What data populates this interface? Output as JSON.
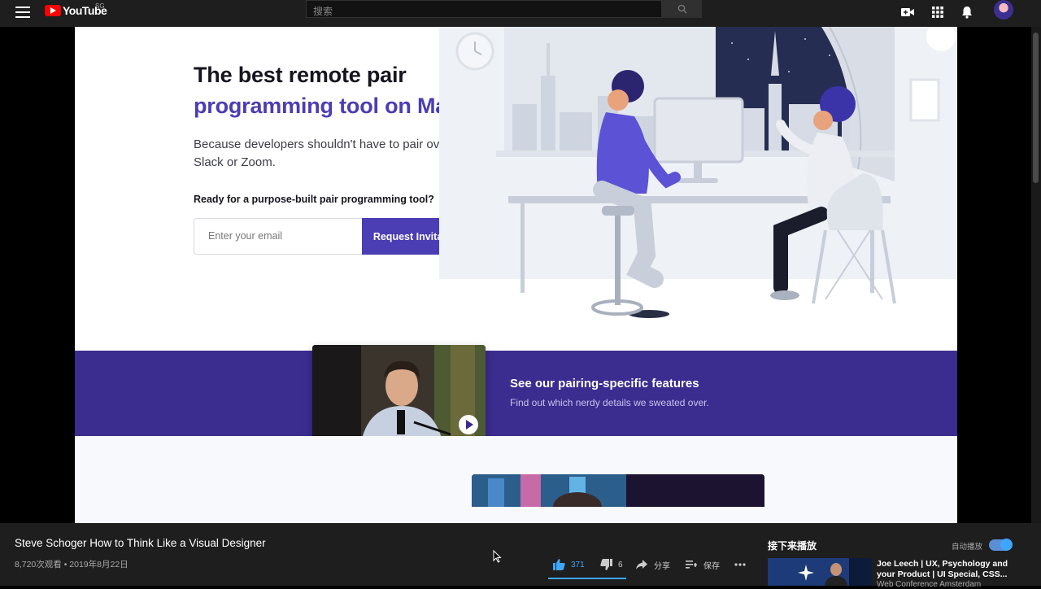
{
  "topbar": {
    "logo_text": "YouTube",
    "region": "SG",
    "search_placeholder": "搜索"
  },
  "page": {
    "hero_title_line1": "The best remote pair",
    "hero_title_line2": "programming tool on Mac",
    "hero_subtitle": "Because developers shouldn't have to pair over Slack or Zoom.",
    "hero_question": "Ready for a purpose-built pair programming tool?",
    "email_placeholder": "Enter your email",
    "request_button": "Request Invitation",
    "features_title": "See our pairing-specific features",
    "features_subtitle": "Find out which nerdy details we sweated over."
  },
  "video": {
    "title": "Steve Schoger How to Think Like a Visual Designer",
    "meta": "8,720次观看 • 2019年8月22日",
    "likes": "371",
    "dislikes": "6",
    "share": "分享",
    "save": "保存"
  },
  "sidebar": {
    "up_next": "接下来播放",
    "autoplay": "自动播放",
    "next_title": "Joe Leech | UX, Psychology and your Product | UI Special, CSS...",
    "next_channel": "Web Conference Amsterdam"
  },
  "colors": {
    "brand_purple": "#4b3db3",
    "band_purple": "#3b2c8f",
    "youtube_red": "#ff0000",
    "accent_blue": "#3ea6ff"
  }
}
